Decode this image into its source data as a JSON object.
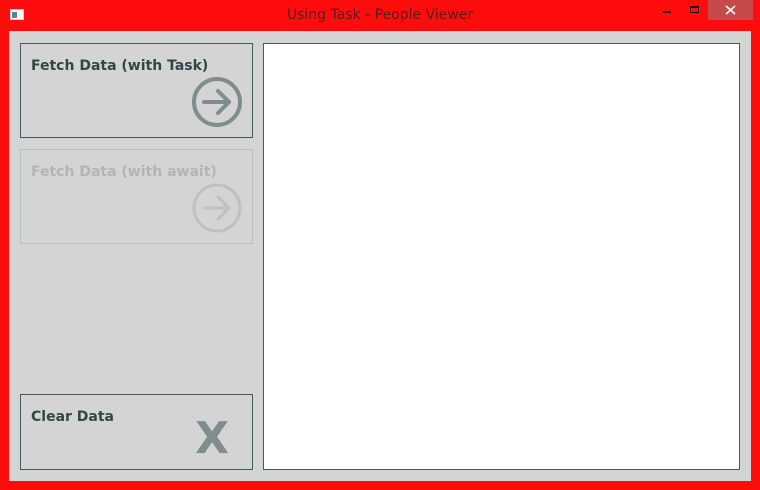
{
  "window": {
    "title": "Using Task - People Viewer"
  },
  "buttons": {
    "fetch_task": {
      "label": "Fetch Data (with Task)",
      "enabled": true,
      "icon": "arrow-right-circle-icon"
    },
    "fetch_await": {
      "label": "Fetch Data (with await)",
      "enabled": false,
      "icon": "arrow-right-circle-icon"
    },
    "clear": {
      "label": "Clear Data",
      "enabled": true,
      "glyph": "X"
    }
  },
  "people_list": {
    "items": []
  },
  "colors": {
    "window_border": "#ff0000",
    "client_bg": "#d4d4d4",
    "text_dark": "#2f4747",
    "icon_gray": "#7e8d8d",
    "disabled_gray": "#b0b6b6"
  }
}
